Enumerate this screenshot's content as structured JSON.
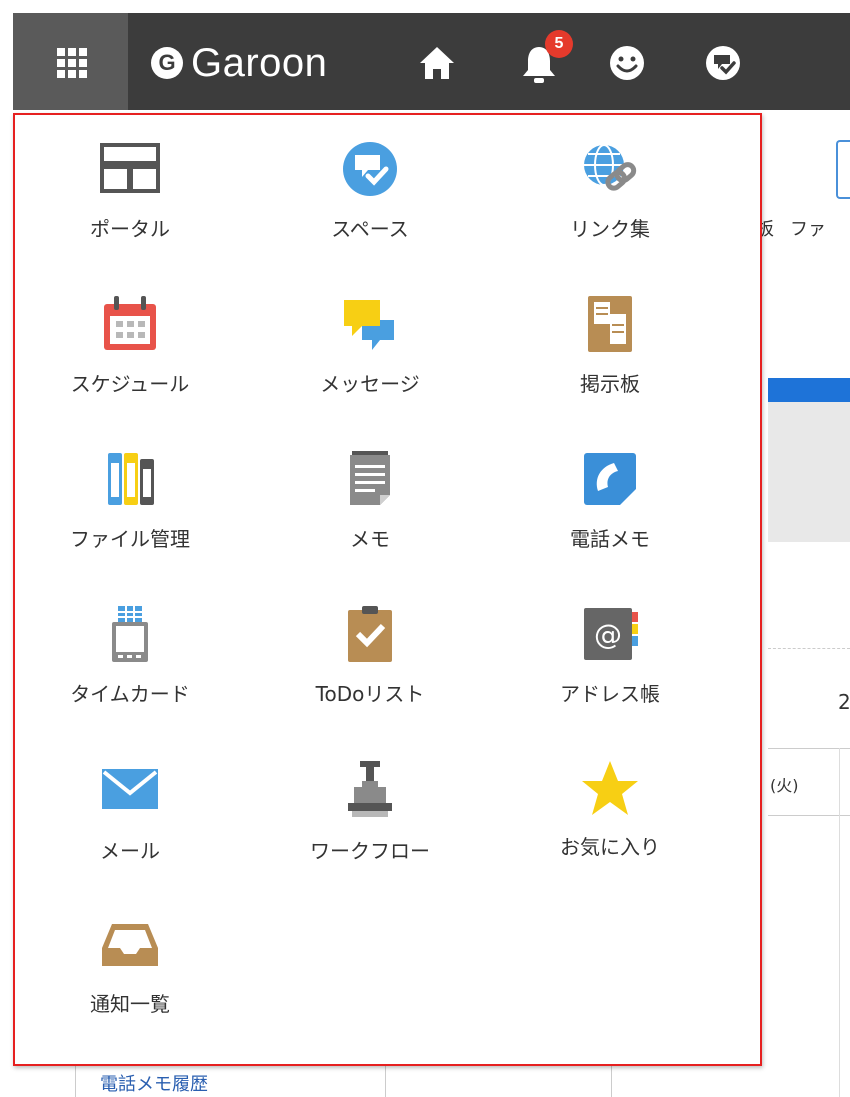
{
  "header": {
    "brand": "Garoon",
    "brand_initial": "G",
    "notification_count": "5"
  },
  "background": {
    "nav_label_1": "板",
    "nav_label_2": "ファ",
    "date_digit": "2",
    "column_fragment": "(火)",
    "bottom_link": "電話メモ履歴"
  },
  "menu": {
    "items": [
      {
        "label": "ポータル",
        "icon": "portal-icon"
      },
      {
        "label": "スペース",
        "icon": "space-icon"
      },
      {
        "label": "リンク集",
        "icon": "link-collection-icon"
      },
      {
        "label": "スケジュール",
        "icon": "calendar-icon"
      },
      {
        "label": "メッセージ",
        "icon": "message-icon"
      },
      {
        "label": "掲示板",
        "icon": "bulletin-board-icon"
      },
      {
        "label": "ファイル管理",
        "icon": "binders-icon"
      },
      {
        "label": "メモ",
        "icon": "memo-icon"
      },
      {
        "label": "電話メモ",
        "icon": "phone-memo-icon"
      },
      {
        "label": "タイムカード",
        "icon": "timecard-icon"
      },
      {
        "label": "ToDoリスト",
        "icon": "todo-clipboard-icon"
      },
      {
        "label": "アドレス帳",
        "icon": "address-book-icon"
      },
      {
        "label": "メール",
        "icon": "mail-icon"
      },
      {
        "label": "ワークフロー",
        "icon": "stamp-icon"
      },
      {
        "label": "お気に入り",
        "icon": "star-icon"
      },
      {
        "label": "通知一覧",
        "icon": "inbox-tray-icon"
      }
    ]
  },
  "colors": {
    "header_bg": "#3c3c3c",
    "menu_border": "#e62020",
    "badge": "#e53a2c",
    "blue": "#4a9fe0"
  }
}
